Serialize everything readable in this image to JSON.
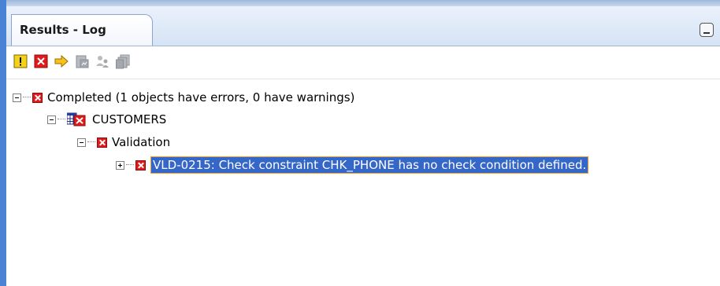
{
  "tab": {
    "label": "Results - Log"
  },
  "toolbar": {
    "icons": [
      "warning-filter-icon",
      "error-filter-icon",
      "goto-arrow-icon",
      "chart-icon",
      "users-icon",
      "copy-icon"
    ]
  },
  "tree": {
    "root": {
      "label": "Completed (1 objects have errors, 0 have warnings)"
    },
    "object": {
      "label": "CUSTOMERS"
    },
    "validation": {
      "label": "Validation"
    },
    "message": {
      "label": "VLD-0215: Check constraint CHK_PHONE has no check condition defined."
    }
  },
  "colors": {
    "accent": "#4a83d6",
    "selection": "#3567c8",
    "selection_border": "#f29b2b",
    "error": "#e01b1b"
  }
}
